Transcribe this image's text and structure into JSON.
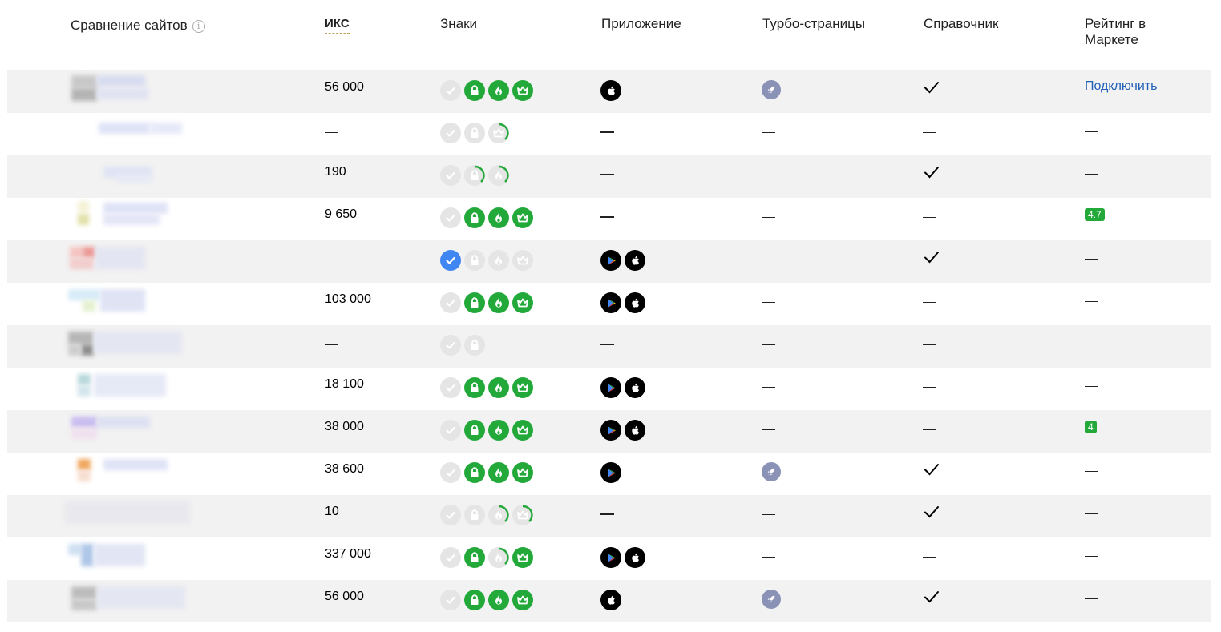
{
  "header": {
    "compare": "Сравнение сайтов",
    "iks": "ИКС",
    "badges": "Знаки",
    "app": "Приложение",
    "turbo": "Турбо-страницы",
    "sprav": "Справочник",
    "market": "Рейтинг в Маркете"
  },
  "dash": "—",
  "link_text": "Подключить",
  "rows": [
    {
      "iks": "56 000",
      "badges": [
        "gray-check",
        "green-lock",
        "green-fire",
        "green-crown"
      ],
      "app": [
        "apple"
      ],
      "turbo": true,
      "sprav": true,
      "market": {
        "type": "link",
        "value": "Подключить"
      }
    },
    {
      "iks": "—",
      "badges": [
        "gray-check",
        "gray-lock",
        "prog-crown"
      ],
      "app": [],
      "turbo": false,
      "sprav": false,
      "market": {
        "type": "dash"
      }
    },
    {
      "iks": "190",
      "badges": [
        "gray-check",
        "prog-lock",
        "prog-fire"
      ],
      "app": [],
      "turbo": false,
      "sprav": true,
      "market": {
        "type": "dash"
      }
    },
    {
      "iks": "9 650",
      "badges": [
        "gray-check",
        "green-lock",
        "green-fire",
        "green-crown"
      ],
      "app": [],
      "turbo": false,
      "sprav": false,
      "market": {
        "type": "rating",
        "value": "4.7"
      }
    },
    {
      "iks": "—",
      "badges": [
        "blue-check",
        "gray-lock",
        "gray-fire",
        "gray-crown"
      ],
      "app": [
        "play",
        "apple"
      ],
      "turbo": false,
      "sprav": true,
      "market": {
        "type": "dash"
      }
    },
    {
      "iks": "103 000",
      "badges": [
        "gray-check",
        "green-lock",
        "green-fire",
        "green-crown"
      ],
      "app": [
        "play",
        "apple"
      ],
      "turbo": false,
      "sprav": false,
      "market": {
        "type": "dash"
      }
    },
    {
      "iks": "—",
      "badges": [
        "gray-check",
        "gray-lock"
      ],
      "app": [],
      "turbo": false,
      "sprav": false,
      "market": {
        "type": "dash"
      }
    },
    {
      "iks": "18 100",
      "badges": [
        "gray-check",
        "green-lock",
        "green-fire",
        "green-crown"
      ],
      "app": [
        "play",
        "apple"
      ],
      "turbo": false,
      "sprav": false,
      "market": {
        "type": "dash"
      }
    },
    {
      "iks": "38 000",
      "badges": [
        "gray-check",
        "green-lock",
        "green-fire",
        "green-crown"
      ],
      "app": [
        "play",
        "apple"
      ],
      "turbo": false,
      "sprav": false,
      "market": {
        "type": "rating",
        "value": "4"
      }
    },
    {
      "iks": "38 600",
      "badges": [
        "gray-check",
        "green-lock",
        "green-fire",
        "green-crown"
      ],
      "app": [
        "play"
      ],
      "turbo": true,
      "sprav": true,
      "market": {
        "type": "dash"
      }
    },
    {
      "iks": "10",
      "badges": [
        "gray-check",
        "gray-lock",
        "prog-fire",
        "prog-crown"
      ],
      "app": [],
      "turbo": false,
      "sprav": true,
      "market": {
        "type": "dash"
      }
    },
    {
      "iks": "337 000",
      "badges": [
        "gray-check",
        "green-lock",
        "prog-fire",
        "green-crown"
      ],
      "app": [
        "play",
        "apple"
      ],
      "turbo": false,
      "sprav": false,
      "market": {
        "type": "dash"
      }
    },
    {
      "iks": "56 000",
      "badges": [
        "gray-check",
        "green-lock",
        "green-fire",
        "green-crown"
      ],
      "app": [
        "apple"
      ],
      "turbo": true,
      "sprav": true,
      "market": {
        "type": "dash"
      }
    }
  ],
  "colors": {
    "green": "#22a93a",
    "gray": "#e5e5e5",
    "blue": "#3f86f2",
    "link": "#1f5fb8"
  }
}
